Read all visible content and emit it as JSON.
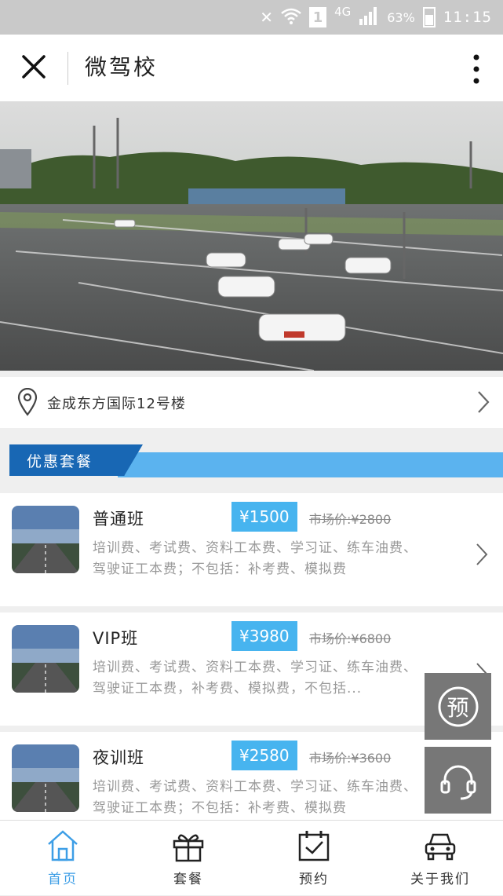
{
  "status_bar": {
    "network": "4G",
    "sim": "1",
    "battery": "63%",
    "time": "11:15"
  },
  "header": {
    "title": "微驾校",
    "close_icon": "close-icon",
    "more_icon": "more-vertical-icon"
  },
  "banner": {
    "slide_count": 2,
    "active_index": 1
  },
  "location": {
    "address": "金成东方国际12号楼",
    "icon": "location-pin-icon"
  },
  "section": {
    "title": "优惠套餐"
  },
  "packages": [
    {
      "name": "普通班",
      "price": "¥1500",
      "market_price": "市场价:¥2800",
      "description": "培训费、考试费、资料工本费、学习证、练车油费、驾驶证工本费；不包括：补考费、模拟费"
    },
    {
      "name": "VIP班",
      "price": "¥3980",
      "market_price": "市场价:¥6800",
      "description": "培训费、考试费、资料工本费、学习证、练车油费、驾驶证工本费，补考费、模拟费，不包括..."
    },
    {
      "name": "夜训班",
      "price": "¥2580",
      "market_price": "市场价:¥3600",
      "description": "培训费、考试费、资料工本费、学习证、练车油费、驾驶证工本费；不包括：补考费、模拟费"
    }
  ],
  "floating": {
    "reserve_label": "预",
    "support_icon": "headset-icon"
  },
  "tabbar": [
    {
      "label": "首页",
      "icon": "home-icon",
      "active": true
    },
    {
      "label": "套餐",
      "icon": "gift-icon",
      "active": false
    },
    {
      "label": "预约",
      "icon": "calendar-check-icon",
      "active": false
    },
    {
      "label": "关于我们",
      "icon": "car-icon",
      "active": false
    }
  ],
  "colors": {
    "accent": "#47b4ef",
    "section_tag": "#1867b4",
    "tab_active": "#3d9ee6"
  }
}
